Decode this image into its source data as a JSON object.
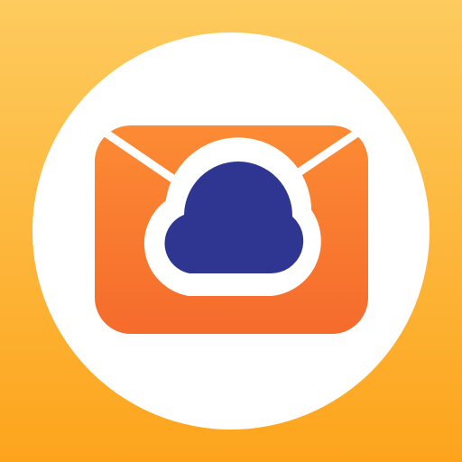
{
  "icon": {
    "name": "mail-cloud-app-icon",
    "glyphs": [
      "envelope-icon",
      "cloud-icon"
    ]
  },
  "colors": {
    "background_top": "#FDCB5E",
    "background_bottom": "#FDA41C",
    "circle": "#FFFFFF",
    "envelope_top": "#FC8B34",
    "envelope_bottom": "#F56B2C",
    "envelope_lines": "#FFFFFF",
    "cloud_fill": "#2E3691",
    "cloud_outline": "#FFFFFF"
  }
}
